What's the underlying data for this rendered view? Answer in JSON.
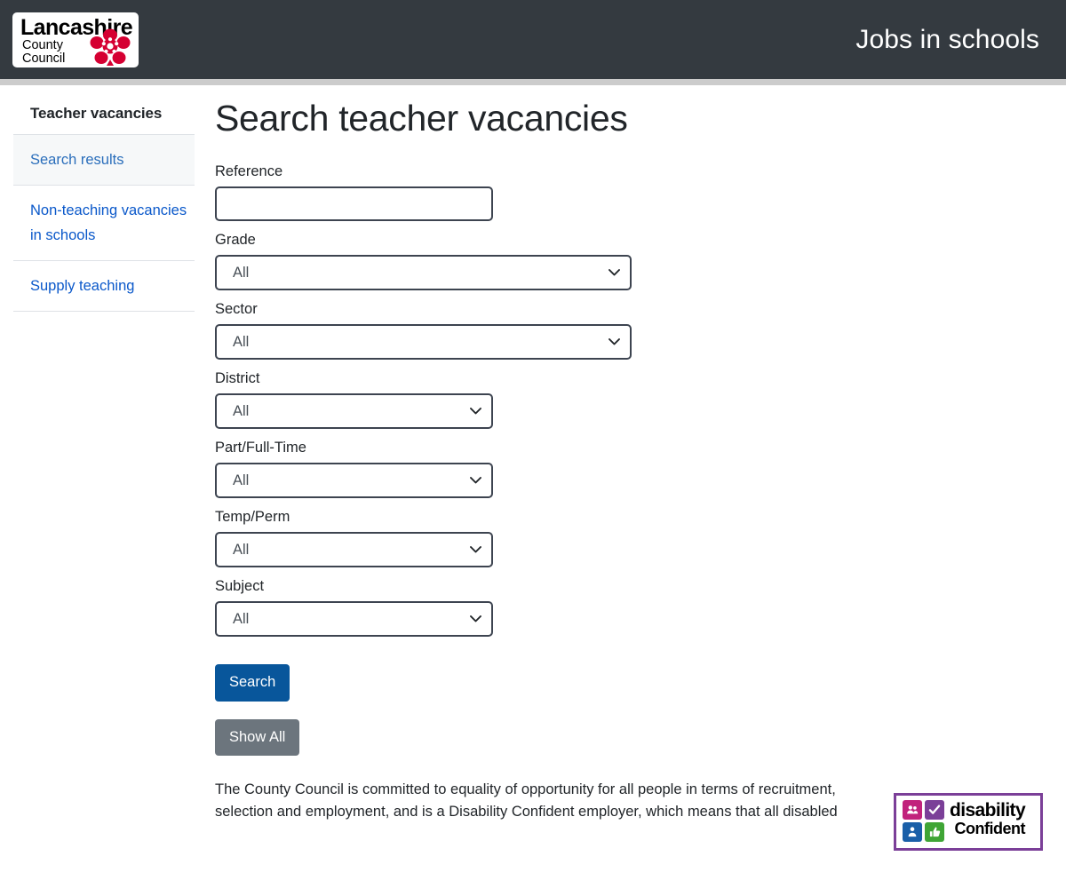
{
  "header": {
    "logo": {
      "word": "Lancashire",
      "line2": "County",
      "line3": "Council",
      "icon": "lancashire-rose-icon"
    },
    "title": "Jobs in schools"
  },
  "sidebar": {
    "title": "Teacher vacancies",
    "items": [
      {
        "label": "Search results",
        "active": true
      },
      {
        "label": "Non-teaching vacancies in schools",
        "active": false
      },
      {
        "label": "Supply teaching",
        "active": false
      }
    ]
  },
  "main": {
    "page_title": "Search teacher vacancies",
    "fields": [
      {
        "label": "Reference",
        "type": "text",
        "value": "",
        "placeholder": ""
      },
      {
        "label": "Grade",
        "type": "select",
        "value": "All",
        "width": "wide"
      },
      {
        "label": "Sector",
        "type": "select",
        "value": "All",
        "width": "wide"
      },
      {
        "label": "District",
        "type": "select",
        "value": "All",
        "width": "narrow"
      },
      {
        "label": "Part/Full-Time",
        "type": "select",
        "value": "All",
        "width": "narrow"
      },
      {
        "label": "Temp/Perm",
        "type": "select",
        "value": "All",
        "width": "narrow"
      },
      {
        "label": "Subject",
        "type": "select",
        "value": "All",
        "width": "narrow"
      }
    ],
    "buttons": {
      "search": "Search",
      "show_all": "Show All"
    },
    "footer_note": "The County Council is committed to equality of opportunity for all people in terms of recruitment, selection and employment, and is a Disability Confident employer, which means that all disabled"
  },
  "badge": {
    "word1": "disability",
    "word2": "Confident",
    "tiles": [
      "people-icon",
      "check-icon",
      "person-icon",
      "thumbs-up-icon"
    ]
  },
  "colors": {
    "header_bg": "#343a40",
    "rule": "#cccccc",
    "link": "#0a58ca",
    "search_button": "#08569b",
    "show_all_button": "#6c757d",
    "badge_border": "#7b3f98",
    "rose": "#d50032"
  }
}
